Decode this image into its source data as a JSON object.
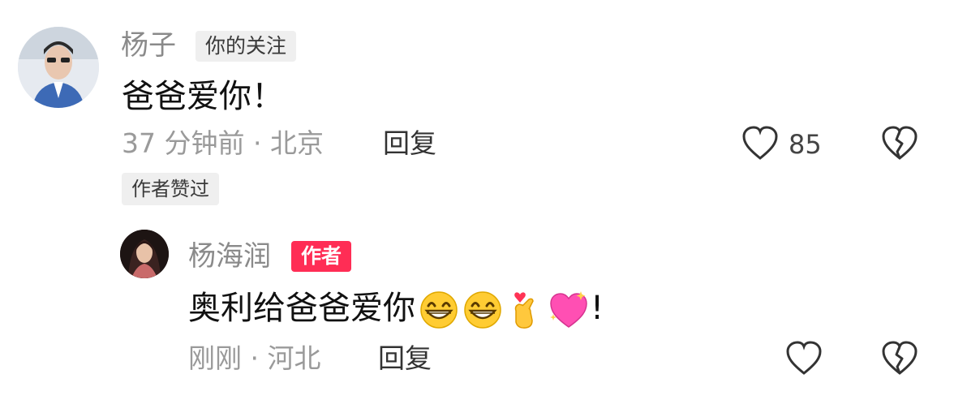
{
  "comment": {
    "username": "杨子",
    "tag": "你的关注",
    "text": "爸爸爱你！",
    "time_location": "37 分钟前 · 北京",
    "reply_label": "回复",
    "like_count": "85",
    "author_liked_label": "作者赞过"
  },
  "reply": {
    "username": "杨海润",
    "tag": "作者",
    "text": "奥利给爸爸爱你",
    "text_end": "!",
    "emojis": [
      "grinning-face",
      "grinning-face",
      "finger-heart",
      "sparkling-heart"
    ],
    "time_location": "刚刚 · 河北",
    "reply_label": "回复"
  },
  "colors": {
    "author_tag": "#ff2d55",
    "meta_gray": "#9a9a9a",
    "username_gray": "#8a8a8a"
  }
}
